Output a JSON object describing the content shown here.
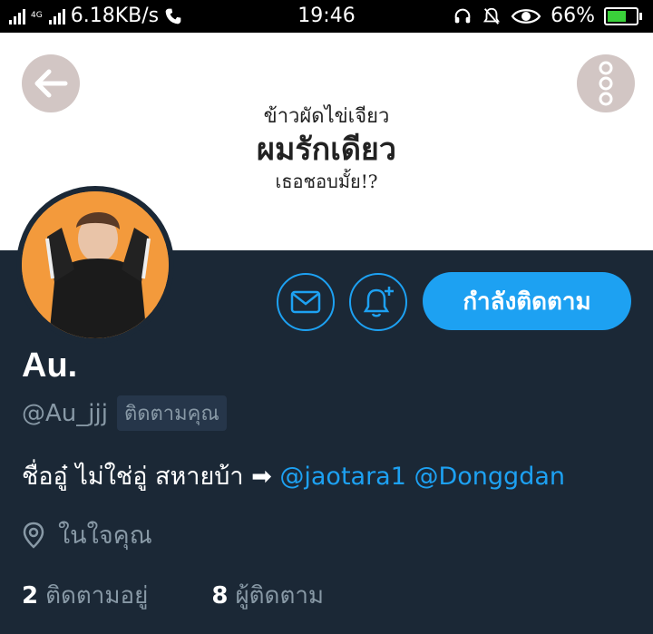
{
  "status_bar": {
    "network": "4G",
    "speed": "6.18KB/s",
    "time": "19:46",
    "battery": "66%",
    "battery_level": 0.66,
    "icons": [
      "signal-icon",
      "signal-icon",
      "phone-icon",
      "headset-icon",
      "bell-off-icon",
      "eye-icon",
      "battery-charging-icon"
    ]
  },
  "banner": {
    "line1": "ข้าวผัดไข่เจียว",
    "line2": "ผมรักเดียว",
    "line3": "เธอชอบมั้ย!?",
    "icons": [
      "back-arrow-icon",
      "more-vertical-icon"
    ]
  },
  "actions": {
    "icons": [
      "mail-icon",
      "bell-plus-icon"
    ],
    "follow_label": "กำลังติดตาม",
    "accent": "#1da1f2"
  },
  "profile": {
    "name": "Au.",
    "handle": "@Au_jjj",
    "follows_you": "ติดตามคุณ",
    "bio_text": "ชื่ออู๋ ไม่ใช่อู่ สหายบ้า ➡ ",
    "mentions": [
      "@jaotara1",
      "@Donggdan"
    ],
    "location": "ในใจคุณ",
    "location_icon": "location-pin-icon"
  },
  "stats": {
    "following_count": "2",
    "following_label": "ติดตามอยู่",
    "followers_count": "8",
    "followers_label": "ผู้ติดตาม"
  }
}
